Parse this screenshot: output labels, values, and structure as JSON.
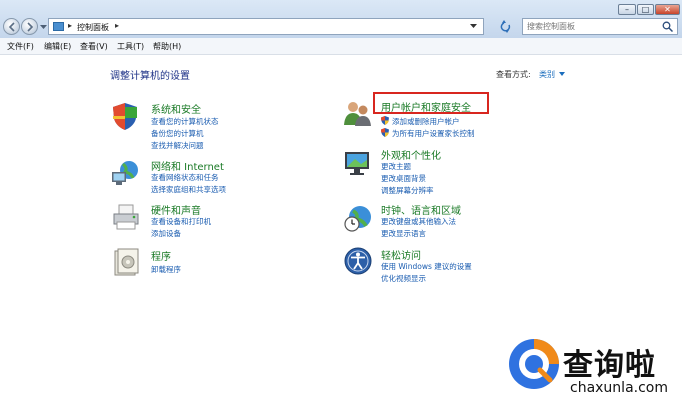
{
  "address_bar": {
    "breadcrumb": "控制面板",
    "search_placeholder": "搜索控制面板"
  },
  "window_controls": {
    "minimize": "–",
    "maximize": "□",
    "close": "✕"
  },
  "menu": [
    "文件(F)",
    "编辑(E)",
    "查看(V)",
    "工具(T)",
    "帮助(H)"
  ],
  "page": {
    "title": "调整计算机的设置",
    "view_by_label": "查看方式:",
    "view_by_value": "类别"
  },
  "categories": [
    {
      "title": "系统和安全",
      "icon": "shield-security-icon",
      "links": [
        "查看您的计算机状态",
        "备份您的计算机",
        "查找并解决问题"
      ]
    },
    {
      "title": "网络和 Internet",
      "icon": "network-globe-icon",
      "links": [
        "查看网络状态和任务",
        "选择家庭组和共享选项"
      ]
    },
    {
      "title": "硬件和声音",
      "icon": "printer-icon",
      "links": [
        "查看设备和打印机",
        "添加设备"
      ]
    },
    {
      "title": "程序",
      "icon": "programs-icon",
      "links": [
        "卸载程序"
      ]
    },
    {
      "title": "用户帐户和家庭安全",
      "icon": "users-icon",
      "links": [
        "添加或删除用户帐户",
        "为所有用户设置家长控制"
      ]
    },
    {
      "title": "外观和个性化",
      "icon": "monitor-icon",
      "links": [
        "更改主题",
        "更改桌面背景",
        "调整屏幕分辨率"
      ]
    },
    {
      "title": "时钟、语言和区域",
      "icon": "clock-globe-icon",
      "links": [
        "更改键盘或其他输入法",
        "更改显示语言"
      ]
    },
    {
      "title": "轻松访问",
      "icon": "ease-of-access-icon",
      "links": [
        "使用 Windows 建议的设置",
        "优化视频显示"
      ]
    }
  ],
  "colors": {
    "category_title": "#1a7a26",
    "link": "#1a5cb0",
    "page_title": "#1e3287",
    "highlight": "#d8261f"
  },
  "watermark": {
    "text": "查询啦",
    "url": "chaxunla.com"
  }
}
